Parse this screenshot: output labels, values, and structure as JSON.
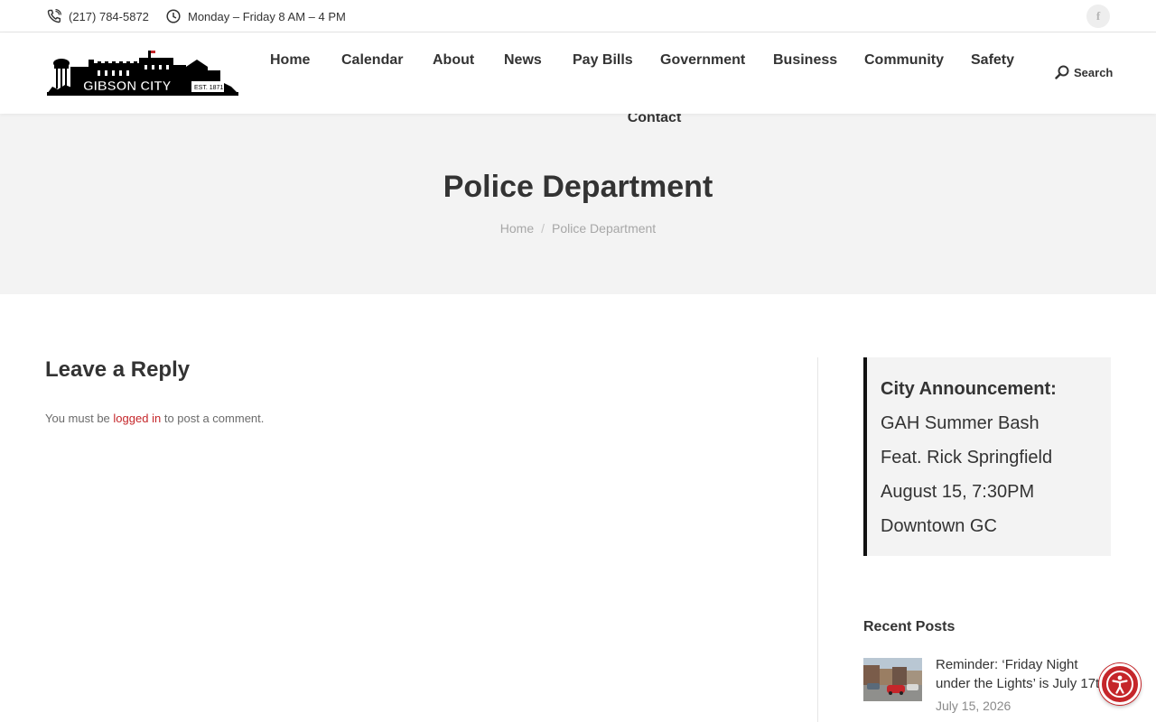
{
  "topbar": {
    "phone": "(217) 784-5872",
    "hours": "Monday – Friday 8 AM – 4 PM",
    "social_icon": "facebook-icon",
    "social_letter": "f"
  },
  "logo": {
    "alt": "Gibson City Est. 1871",
    "text": "GIBSON CITY",
    "est": "EST. 1871"
  },
  "nav": {
    "items": [
      {
        "label": "Home"
      },
      {
        "label": "Calendar"
      },
      {
        "label": "About"
      },
      {
        "label": "News"
      },
      {
        "label": "Pay Bills"
      },
      {
        "label": "Government"
      },
      {
        "label": "Business"
      },
      {
        "label": "Community"
      },
      {
        "label": "Safety"
      },
      {
        "label": "Contact"
      }
    ],
    "search_label": "Search"
  },
  "page": {
    "title": "Police Department",
    "breadcrumbs": [
      "Home",
      "Police Department"
    ]
  },
  "reply": {
    "title": "Leave a Reply",
    "note_before": "You must be",
    "note_link": "logged in",
    "note_after": "to post a comment."
  },
  "sidebar": {
    "announcement": {
      "heading": "City Announcement:",
      "lines": [
        "GAH Summer Bash",
        "Feat. Rick Springfield",
        "August 15, 7:30PM",
        "Downtown GC"
      ]
    },
    "recent_title": "Recent Posts",
    "posts": [
      {
        "title_line1": "Reminder: ‘Friday Night",
        "title_line2": "under the Lights’ is July 17th",
        "date": "July 15, 2026"
      }
    ]
  },
  "colors": {
    "accent": "#c5262a",
    "text": "#333333",
    "band": "#f3f3f3"
  }
}
